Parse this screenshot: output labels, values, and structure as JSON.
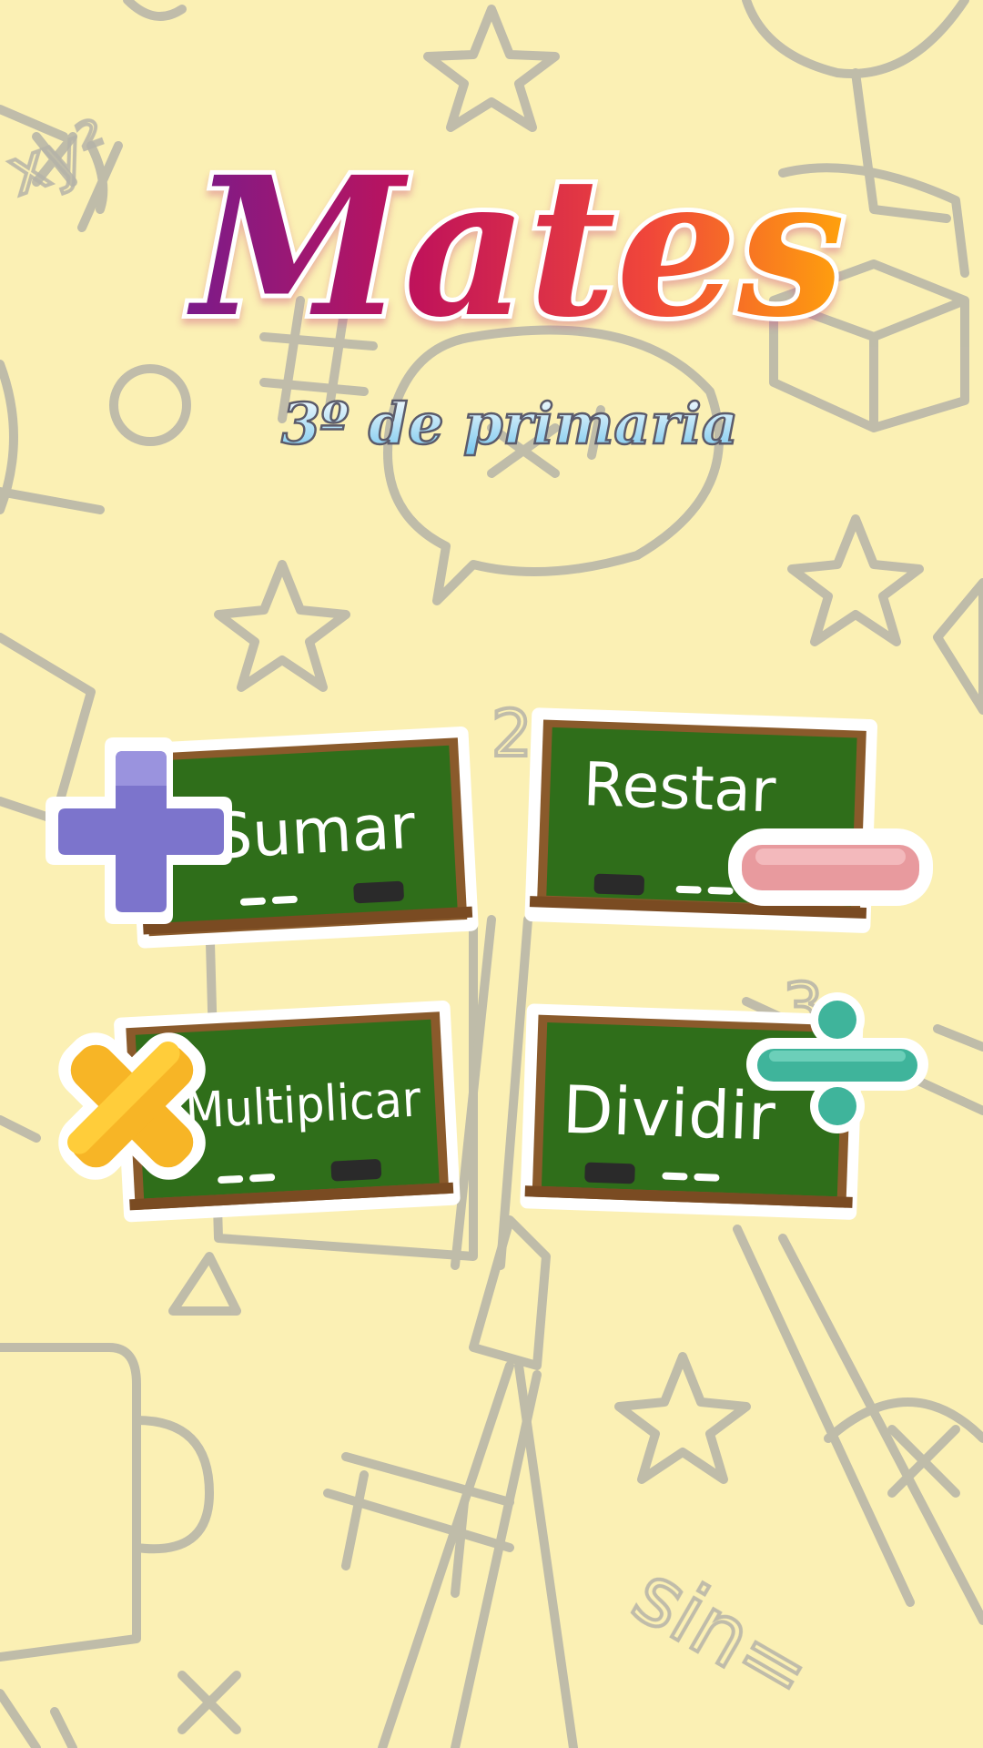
{
  "app": {
    "title": "Mates",
    "subtitle": "3º de primaria"
  },
  "menu": {
    "sumar": {
      "label": "Sumar",
      "icon": "plus-icon"
    },
    "restar": {
      "label": "Restar",
      "icon": "minus-icon"
    },
    "multiplicar": {
      "label": "Multiplicar",
      "icon": "multiply-icon"
    },
    "dividir": {
      "label": "Dividir",
      "icon": "divide-icon"
    }
  },
  "background": {
    "doodle_text_1": "xy²",
    "doodle_text_2": "sin=",
    "doodle_text_3": "2",
    "doodle_text_4": "3"
  },
  "colors": {
    "background": "#fbf0b4",
    "doodle": "#b4b4b4",
    "board_green": "#2f6e1a",
    "board_frame": "#8a5a2b",
    "plus": "#7c74cc",
    "minus": "#e89a9e",
    "multiply": "#f7b526",
    "divide": "#3fb49b"
  }
}
